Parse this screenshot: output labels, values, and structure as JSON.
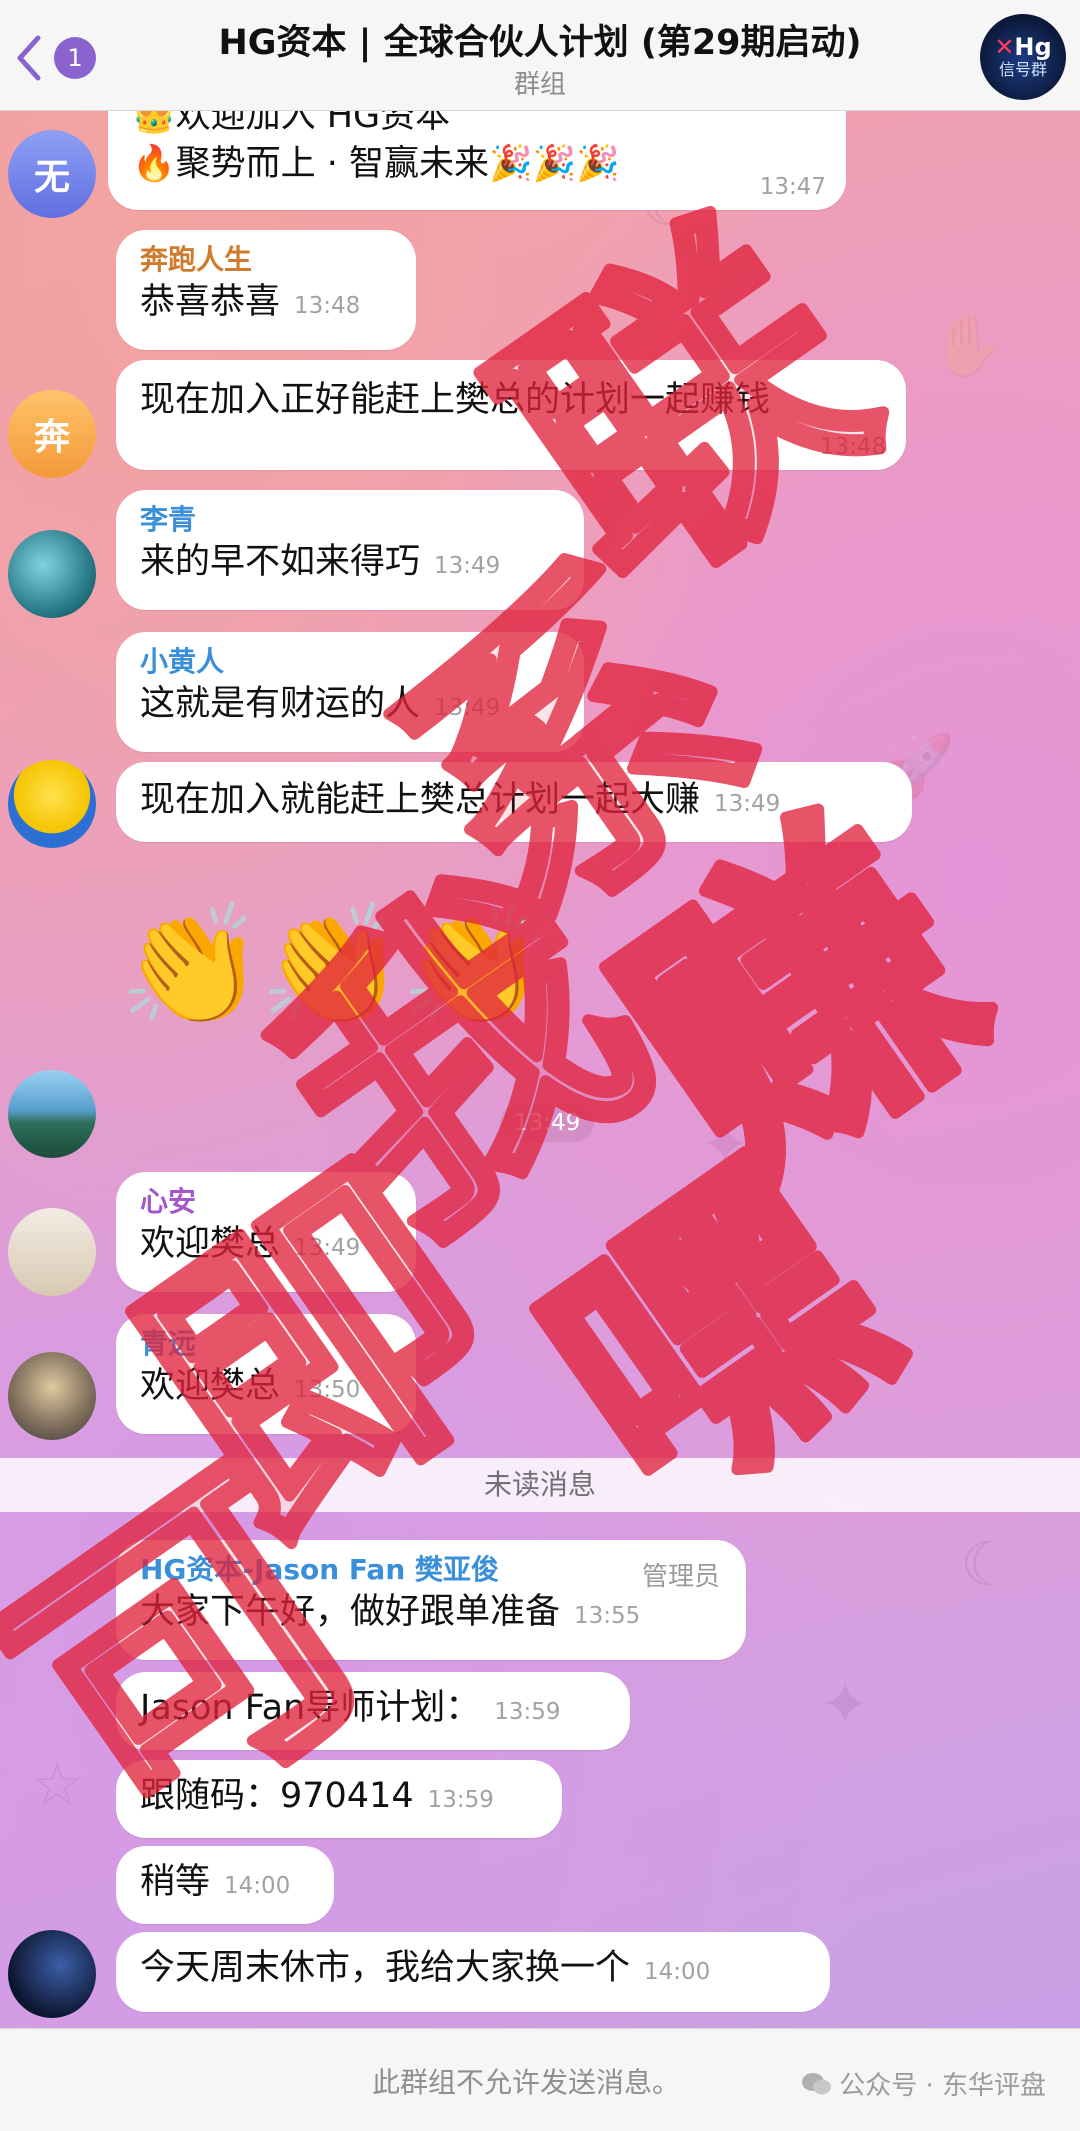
{
  "header": {
    "back_badge": "1",
    "title": "HG资本 | 全球合伙人计划 (第29期启动)",
    "subtitle": "群组",
    "group_avatar_top": "Hg",
    "group_avatar_sub": "信号群"
  },
  "messages": [
    {
      "line1": "👑欢迎加入 HG资本",
      "line2": "🔥聚势而上 · 智赢未来🎉🎉🎉",
      "time": "13:47",
      "avatar_letter": "无"
    },
    {
      "sender": "奔跑人生",
      "text": "恭喜恭喜",
      "time": "13:48"
    },
    {
      "text": "现在加入正好能赶上樊总的计划一起赚钱",
      "time": "13:48",
      "avatar_letter": "奔"
    },
    {
      "sender": "李青",
      "text": "来的早不如来得巧",
      "time": "13:49"
    },
    {
      "sender": "小黄人",
      "text": "这就是有财运的人",
      "time": "13:49"
    },
    {
      "text": "现在加入就能赶上樊总计划一起大赚",
      "time": "13:49"
    },
    {
      "emoji": "👏👏👏",
      "time": "13:49"
    },
    {
      "sender": "心安",
      "text": "欢迎樊总",
      "time": "13:49"
    },
    {
      "sender": "青远",
      "text": "欢迎樊总",
      "time": "13:50"
    }
  ],
  "unread_divider": "未读消息",
  "admin_messages": [
    {
      "sender": "HG资本-Jason Fan 樊亚俊",
      "role": "管理员",
      "text": "大家下午好，做好跟单准备",
      "time": "13:55"
    },
    {
      "text": "Jason Fan导师计划：",
      "time": "13:59"
    },
    {
      "text": "跟随码：970414",
      "time": "13:59"
    },
    {
      "text": "稍等",
      "time": "14:00"
    },
    {
      "text": "今天周末休市，我给大家换一个",
      "time": "14:00"
    }
  ],
  "bottom": {
    "notice": "此群组不允许发送消息。",
    "watermark": "公众号 · 东华评盘"
  },
  "stamp_text": "联系我即可赚，嘿嘿",
  "colors": {
    "accent": "#8a63cf",
    "sender_orange": "#d07a2c",
    "sender_blue": "#3a8fd8",
    "sender_purple": "#a357c9",
    "stamp_red": "#e0233d"
  }
}
